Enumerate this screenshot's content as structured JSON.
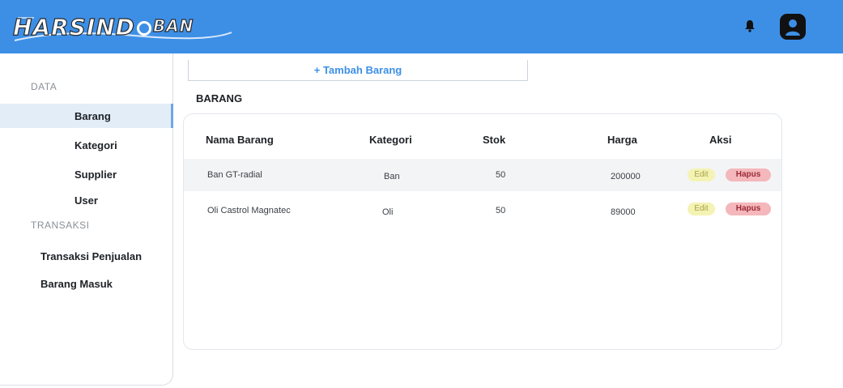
{
  "header": {
    "logo_main": "HARSIND",
    "logo_sub": "BAN",
    "icons": {
      "notification": "bell-icon",
      "account": "user-icon"
    },
    "color": "#3d8fe6"
  },
  "sidebar": {
    "section_data": "DATA",
    "items_data": [
      {
        "label": "Barang",
        "active": true
      },
      {
        "label": "Kategori"
      },
      {
        "label": "Supplier"
      },
      {
        "label": "User"
      }
    ],
    "section_transaksi": "TRANSAKSI",
    "items_transaksi": [
      {
        "label": "Transaksi Penjualan"
      },
      {
        "label": "Barang Masuk"
      }
    ]
  },
  "main": {
    "add_button": "+ Tambah Barang",
    "title": "BARANG",
    "table": {
      "headers": [
        "Nama Barang",
        "Kategori",
        "Stok",
        "Harga",
        "Aksi"
      ],
      "rows": [
        {
          "nama": "Ban GT-radial",
          "kategori": "Ban",
          "stok": "50",
          "harga": "200000",
          "edit": "Edit",
          "hapus": "Hapus"
        },
        {
          "nama": "Oli Castrol Magnatec",
          "kategori": "Oli",
          "stok": "50",
          "harga": "89000",
          "edit": "Edit",
          "hapus": "Hapus"
        }
      ]
    }
  }
}
